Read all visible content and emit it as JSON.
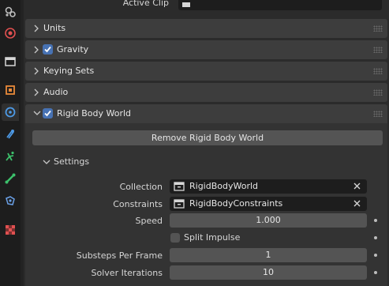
{
  "colors": {
    "accent": "#4772b3",
    "panel": "#2b2b2b",
    "header": "#3d3d3d",
    "field": "#545454"
  },
  "tabs": [
    {
      "name": "tool-icon",
      "color": "#a6a6a6"
    },
    {
      "name": "render-icon",
      "color": "#e05050"
    },
    {
      "name": "output-icon",
      "color": "#d6d6d6"
    },
    {
      "name": "object-icon",
      "color": "#e8893a"
    },
    {
      "name": "physics-icon",
      "color": "#4d9ae6"
    },
    {
      "name": "constraint-icon",
      "color": "#4d9ae6"
    },
    {
      "name": "particles-icon",
      "color": "#3cc06b"
    },
    {
      "name": "bone-icon",
      "color": "#3cc06b"
    },
    {
      "name": "object-data-icon",
      "color": "#6aa0e6"
    },
    {
      "name": "texture-icon",
      "color": "#e05050"
    }
  ],
  "top_field": {
    "label": "Active Clip"
  },
  "sections": {
    "units": "Units",
    "gravity": "Gravity",
    "keying_sets": "Keying Sets",
    "audio": "Audio",
    "rigid_body_world": "Rigid Body World"
  },
  "rigid_body": {
    "remove_button": "Remove Rigid Body World",
    "settings_label": "Settings",
    "collection": {
      "label": "Collection",
      "value": "RigidBodyWorld"
    },
    "constraints": {
      "label": "Constraints",
      "value": "RigidBodyConstraints"
    },
    "speed": {
      "label": "Speed",
      "value": "1.000"
    },
    "split_impulse": {
      "label": "Split Impulse",
      "checked": false
    },
    "substeps": {
      "label": "Substeps Per Frame",
      "value": "1"
    },
    "solver_iterations": {
      "label": "Solver Iterations",
      "value": "10"
    }
  }
}
